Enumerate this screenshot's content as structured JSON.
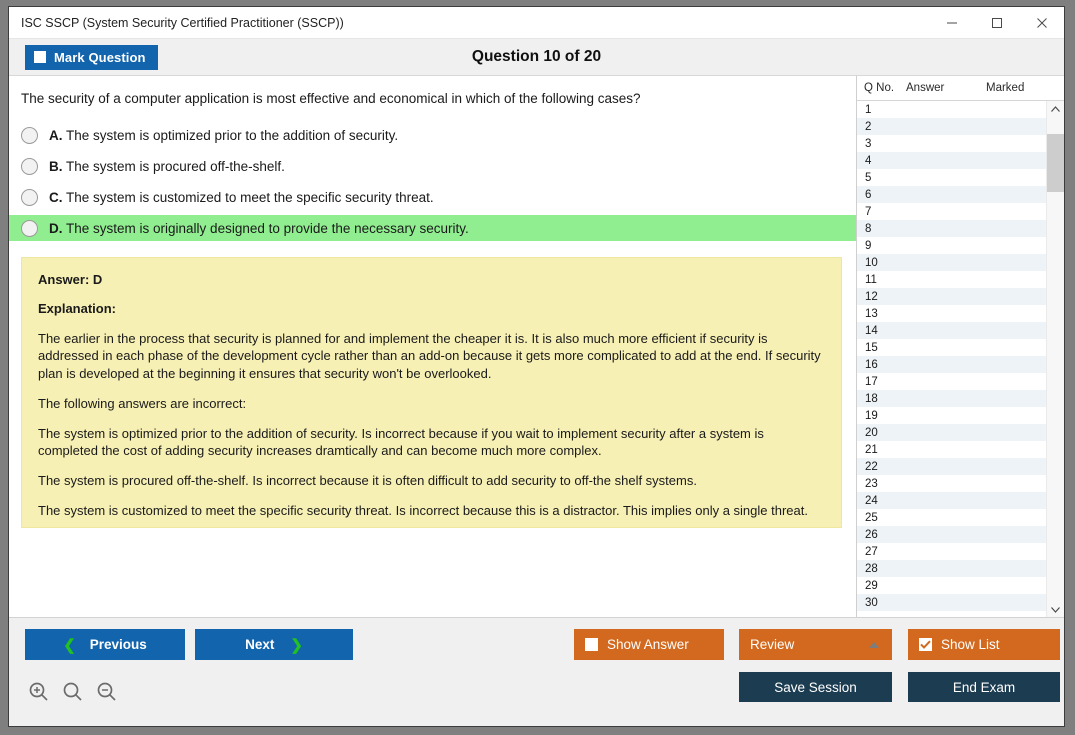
{
  "window": {
    "title": "ISC SSCP (System Security Certified Practitioner (SSCP))",
    "minimize_label": "—",
    "maximize_label": "□",
    "close_label": "✕"
  },
  "header": {
    "mark_question_label": "Mark Question",
    "question_title": "Question 10 of 20"
  },
  "question": {
    "text": "The security of a computer application is most effective and economical in which of the following cases?",
    "options": [
      {
        "letter": "A.",
        "text": "The system is optimized prior to the addition of security.",
        "correct": false
      },
      {
        "letter": "B.",
        "text": "The system is procured off-the-shelf.",
        "correct": false
      },
      {
        "letter": "C.",
        "text": "The system is customized to meet the specific security threat.",
        "correct": false
      },
      {
        "letter": "D.",
        "text": "The system is originally designed to provide the necessary security.",
        "correct": true
      }
    ]
  },
  "explanation": {
    "answer_label": "Answer: D",
    "explanation_label": "Explanation:",
    "paragraphs": [
      "The earlier in the process that security is planned for and implement the cheaper it is. It is also much more efficient if security is addressed in each phase of the development cycle rather than an add-on because it gets more complicated to add at the end. If security plan is developed at the beginning it ensures that security won't be overlooked.",
      "The following answers are incorrect:",
      "The system is optimized prior to the addition of security. Is incorrect because if you wait to implement security after a system is completed the cost of adding security increases dramtically and can become much more complex.",
      "The system is procured off-the-shelf. Is incorrect because it is often difficult to add security to off-the shelf systems.",
      "The system is customized to meet the specific security threat. Is incorrect because this is a distractor. This implies only a single threat."
    ]
  },
  "list": {
    "columns": [
      "Q No.",
      "Answer",
      "Marked"
    ],
    "rows": [
      {
        "no": "1",
        "answer": "",
        "marked": ""
      },
      {
        "no": "2",
        "answer": "",
        "marked": ""
      },
      {
        "no": "3",
        "answer": "",
        "marked": ""
      },
      {
        "no": "4",
        "answer": "",
        "marked": ""
      },
      {
        "no": "5",
        "answer": "",
        "marked": ""
      },
      {
        "no": "6",
        "answer": "",
        "marked": ""
      },
      {
        "no": "7",
        "answer": "",
        "marked": ""
      },
      {
        "no": "8",
        "answer": "",
        "marked": ""
      },
      {
        "no": "9",
        "answer": "",
        "marked": ""
      },
      {
        "no": "10",
        "answer": "",
        "marked": ""
      },
      {
        "no": "11",
        "answer": "",
        "marked": ""
      },
      {
        "no": "12",
        "answer": "",
        "marked": ""
      },
      {
        "no": "13",
        "answer": "",
        "marked": ""
      },
      {
        "no": "14",
        "answer": "",
        "marked": ""
      },
      {
        "no": "15",
        "answer": "",
        "marked": ""
      },
      {
        "no": "16",
        "answer": "",
        "marked": ""
      },
      {
        "no": "17",
        "answer": "",
        "marked": ""
      },
      {
        "no": "18",
        "answer": "",
        "marked": ""
      },
      {
        "no": "19",
        "answer": "",
        "marked": ""
      },
      {
        "no": "20",
        "answer": "",
        "marked": ""
      },
      {
        "no": "21",
        "answer": "",
        "marked": ""
      },
      {
        "no": "22",
        "answer": "",
        "marked": ""
      },
      {
        "no": "23",
        "answer": "",
        "marked": ""
      },
      {
        "no": "24",
        "answer": "",
        "marked": ""
      },
      {
        "no": "25",
        "answer": "",
        "marked": ""
      },
      {
        "no": "26",
        "answer": "",
        "marked": ""
      },
      {
        "no": "27",
        "answer": "",
        "marked": ""
      },
      {
        "no": "28",
        "answer": "",
        "marked": ""
      },
      {
        "no": "29",
        "answer": "",
        "marked": ""
      },
      {
        "no": "30",
        "answer": "",
        "marked": ""
      }
    ]
  },
  "footer": {
    "previous_label": "Previous",
    "next_label": "Next",
    "show_answer_label": "Show Answer",
    "review_label": "Review",
    "show_list_label": "Show List",
    "save_session_label": "Save Session",
    "end_exam_label": "End Exam",
    "zoom_in_icon": "zoom-in-icon",
    "zoom_reset_icon": "zoom-reset-icon",
    "zoom_out_icon": "zoom-out-icon",
    "show_answer_checked": false,
    "show_list_checked": true
  },
  "colors": {
    "accent_blue": "#1264ad",
    "accent_orange": "#d2691e",
    "navy": "#1c3c52",
    "correct_green": "#90ee90",
    "explain_yellow": "#f7f0b5"
  }
}
